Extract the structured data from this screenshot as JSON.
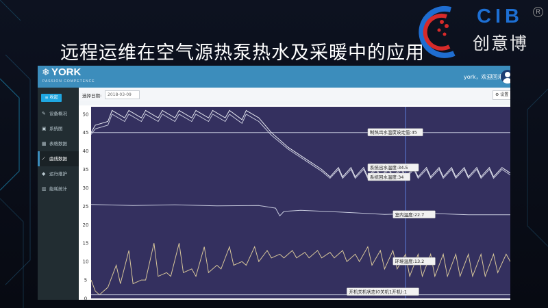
{
  "slide": {
    "title": "远程运维在空气源热泵热水及采暖中的应用",
    "logo": {
      "text": "CIB",
      "chinese": "创意博",
      "registered": "R"
    }
  },
  "app": {
    "brand": {
      "name": "YORK",
      "subtitle": "PASSION COMPETENCE"
    },
    "welcome": "york，欢迎回来!",
    "toolbar": {
      "date_label": "选择日期:",
      "date_value": "2018-03-09",
      "settings_label": "设置"
    },
    "sidebar": {
      "collapse_label": "收起",
      "items": [
        {
          "label": "设备概况",
          "icon": "edit-icon"
        },
        {
          "label": "系统图",
          "icon": "image-icon"
        },
        {
          "label": "表格数据",
          "icon": "table-icon"
        },
        {
          "label": "曲线数据",
          "icon": "line-chart-icon"
        },
        {
          "label": "运行维护",
          "icon": "diamond-icon"
        },
        {
          "label": "能耗统计",
          "icon": "bar-chart-icon"
        }
      ],
      "active_index": 3
    },
    "colors": {
      "header": "#3c8dbc",
      "sidebar": "#222d32",
      "plot_bg": "#34305f",
      "accent": "#1fa7e1",
      "line": "#e4e6ee",
      "env_line": "#d8c79a"
    }
  },
  "chart_data": {
    "type": "line",
    "ylim": [
      0,
      52
    ],
    "yticks": [
      0,
      5,
      10,
      15,
      20,
      25,
      30,
      35,
      40,
      45,
      50
    ],
    "xlim": [
      0,
      100
    ],
    "cursor_x": 75,
    "series": [
      {
        "name": "制热出水温度设定值",
        "color": "#b9bcd3",
        "label_value": "45",
        "label_text": "制热出水温度设定值:45",
        "label_x": 66,
        "x": [
          0,
          100
        ],
        "y": [
          45,
          45
        ]
      },
      {
        "name": "系统出水温度",
        "color": "#e8eaf2",
        "label_value": "34.5",
        "label_text": "系统出水温度:34.5",
        "label_x": 66,
        "x": [
          0,
          1,
          4,
          5,
          8,
          9,
          12,
          13,
          16,
          17,
          20,
          21,
          24,
          25,
          28,
          29,
          32,
          33,
          36,
          37,
          40,
          43,
          47,
          51,
          55,
          57,
          59,
          60,
          62,
          63,
          65,
          66,
          68,
          69,
          71,
          72,
          74,
          75,
          77,
          78,
          80,
          81,
          83,
          84,
          86,
          87,
          89,
          90,
          92,
          93,
          95,
          96,
          98,
          100
        ],
        "y": [
          45,
          47,
          48,
          51,
          49,
          51,
          49,
          51,
          49,
          51,
          49,
          51,
          49,
          51,
          49,
          51,
          49,
          51,
          48.5,
          51,
          49,
          45,
          41,
          38,
          35,
          33,
          35.5,
          33,
          35.5,
          33,
          35.5,
          33,
          35.5,
          33,
          35.5,
          33,
          35.5,
          33,
          35.5,
          33,
          35.5,
          33,
          35.5,
          33,
          35.5,
          33,
          35.5,
          33,
          35.5,
          33,
          35.5,
          33,
          35.5,
          34
        ]
      },
      {
        "name": "系统回水温度",
        "color": "#c9cbdc",
        "label_value": "34",
        "label_text": "系统回水温度:34",
        "label_x": 66,
        "x": [
          0,
          1,
          4,
          5,
          8,
          9,
          12,
          13,
          16,
          17,
          20,
          21,
          24,
          25,
          28,
          29,
          32,
          33,
          36,
          37,
          40,
          43,
          47,
          51,
          55,
          57,
          59,
          60,
          62,
          63,
          65,
          66,
          68,
          69,
          71,
          72,
          74,
          75,
          77,
          78,
          80,
          81,
          83,
          84,
          86,
          87,
          89,
          90,
          92,
          93,
          95,
          96,
          98,
          100
        ],
        "y": [
          44.5,
          46,
          47,
          50,
          48,
          50,
          48,
          50,
          48,
          50,
          48,
          50,
          48,
          50,
          48,
          50,
          48,
          50,
          47.5,
          50,
          48,
          44.3,
          40.5,
          37.5,
          34.5,
          32.6,
          35,
          32.6,
          35,
          32.6,
          35,
          32.6,
          35,
          32.6,
          35,
          32.6,
          35,
          32.6,
          35,
          32.6,
          35,
          32.6,
          35,
          32.6,
          35,
          32.6,
          35,
          32.6,
          35,
          32.6,
          35,
          32.6,
          35,
          33.5
        ]
      },
      {
        "name": "室内温度",
        "color": "#c5c8dc",
        "label_value": "22.7",
        "label_text": "室内温度:22.7",
        "label_x": 72,
        "x": [
          0,
          10,
          20,
          30,
          40,
          44,
          45,
          46,
          50,
          60,
          70,
          80,
          90,
          100
        ],
        "y": [
          25.5,
          25.2,
          25.4,
          25.1,
          25.2,
          24.5,
          22.4,
          23.6,
          23.9,
          23.4,
          22.8,
          23.1,
          22.7,
          22.7
        ]
      },
      {
        "name": "环境温度",
        "color": "#d8c79a",
        "label_value": "13.2",
        "label_text": "环境温度:13.2",
        "label_x": 72,
        "x": [
          0,
          1,
          2,
          4,
          6,
          7,
          9,
          10,
          12,
          13,
          15,
          16,
          18,
          19,
          21,
          22,
          24,
          25,
          27,
          28,
          30,
          31,
          33,
          34,
          36,
          37,
          39,
          40,
          42,
          43,
          45,
          46,
          48,
          49,
          51,
          52,
          54,
          55,
          57,
          58,
          60,
          61,
          63,
          64,
          66,
          67,
          69,
          70,
          72,
          73,
          75,
          76,
          78,
          79,
          81,
          82,
          84,
          85,
          87,
          88,
          90,
          91,
          93,
          94,
          96,
          97,
          99,
          100
        ],
        "y": [
          5,
          2,
          1,
          3,
          9,
          4,
          13,
          4,
          5,
          5,
          15,
          6,
          7,
          6,
          15,
          7,
          8,
          6,
          14,
          7,
          9,
          8,
          14,
          9,
          10,
          9,
          14,
          10,
          13,
          11,
          12,
          11,
          13,
          11,
          12.5,
          11,
          13,
          11,
          12.5,
          11,
          13,
          10,
          12,
          10,
          14,
          9,
          13,
          8,
          13,
          8,
          12,
          6,
          12,
          6,
          12,
          6,
          12,
          6,
          12,
          6,
          12,
          6,
          12,
          6,
          12,
          7,
          12,
          10
        ]
      },
      {
        "name": "开机关机状态(0关机1开机)",
        "color": "#b9bcd3",
        "label_value": "1",
        "label_text": "开机关机状态(0关机1开机):1",
        "label_x": 61,
        "x": [
          0,
          100
        ],
        "y": [
          1,
          1
        ]
      }
    ]
  }
}
